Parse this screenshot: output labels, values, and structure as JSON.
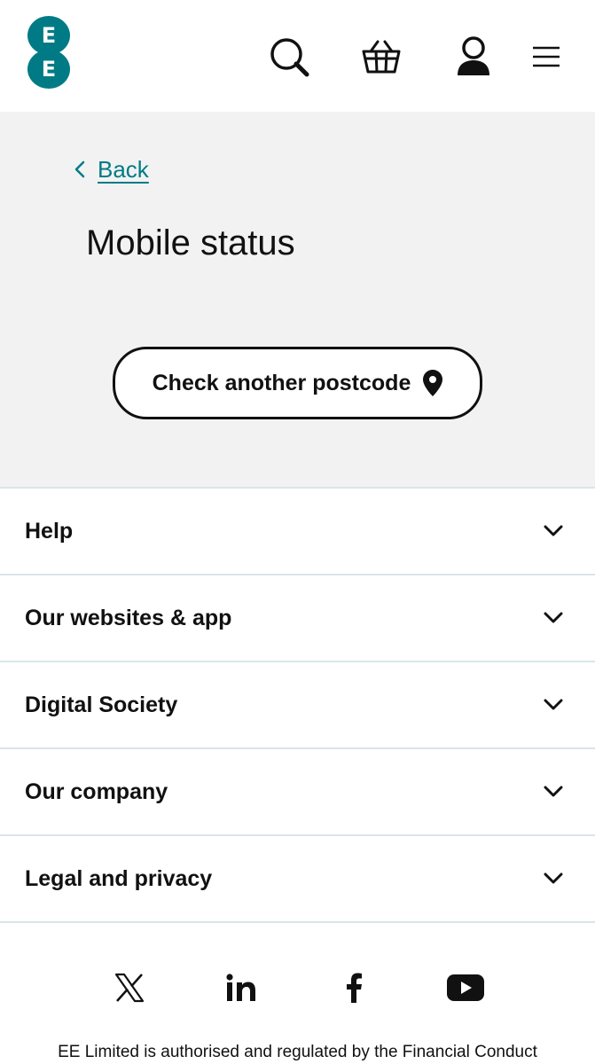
{
  "brand": {
    "logo_letters": [
      "E",
      "E"
    ],
    "accent_color": "#007b85"
  },
  "header": {
    "icons": [
      "search-icon",
      "basket-icon",
      "account-icon",
      "menu-icon"
    ]
  },
  "panel": {
    "back_label": "Back",
    "title": "Mobile status",
    "postcode_button_label": "Check another postcode",
    "postcode_button_icon": "location-pin-icon"
  },
  "footer": {
    "sections": [
      {
        "label": "Help"
      },
      {
        "label": "Our websites & app"
      },
      {
        "label": "Digital Society"
      },
      {
        "label": "Our company"
      },
      {
        "label": "Legal and privacy"
      }
    ],
    "social_icons": [
      "x-icon",
      "linkedin-icon",
      "facebook-icon",
      "youtube-icon"
    ],
    "legal_text": "EE Limited is authorised and regulated by the Financial Conduct"
  }
}
